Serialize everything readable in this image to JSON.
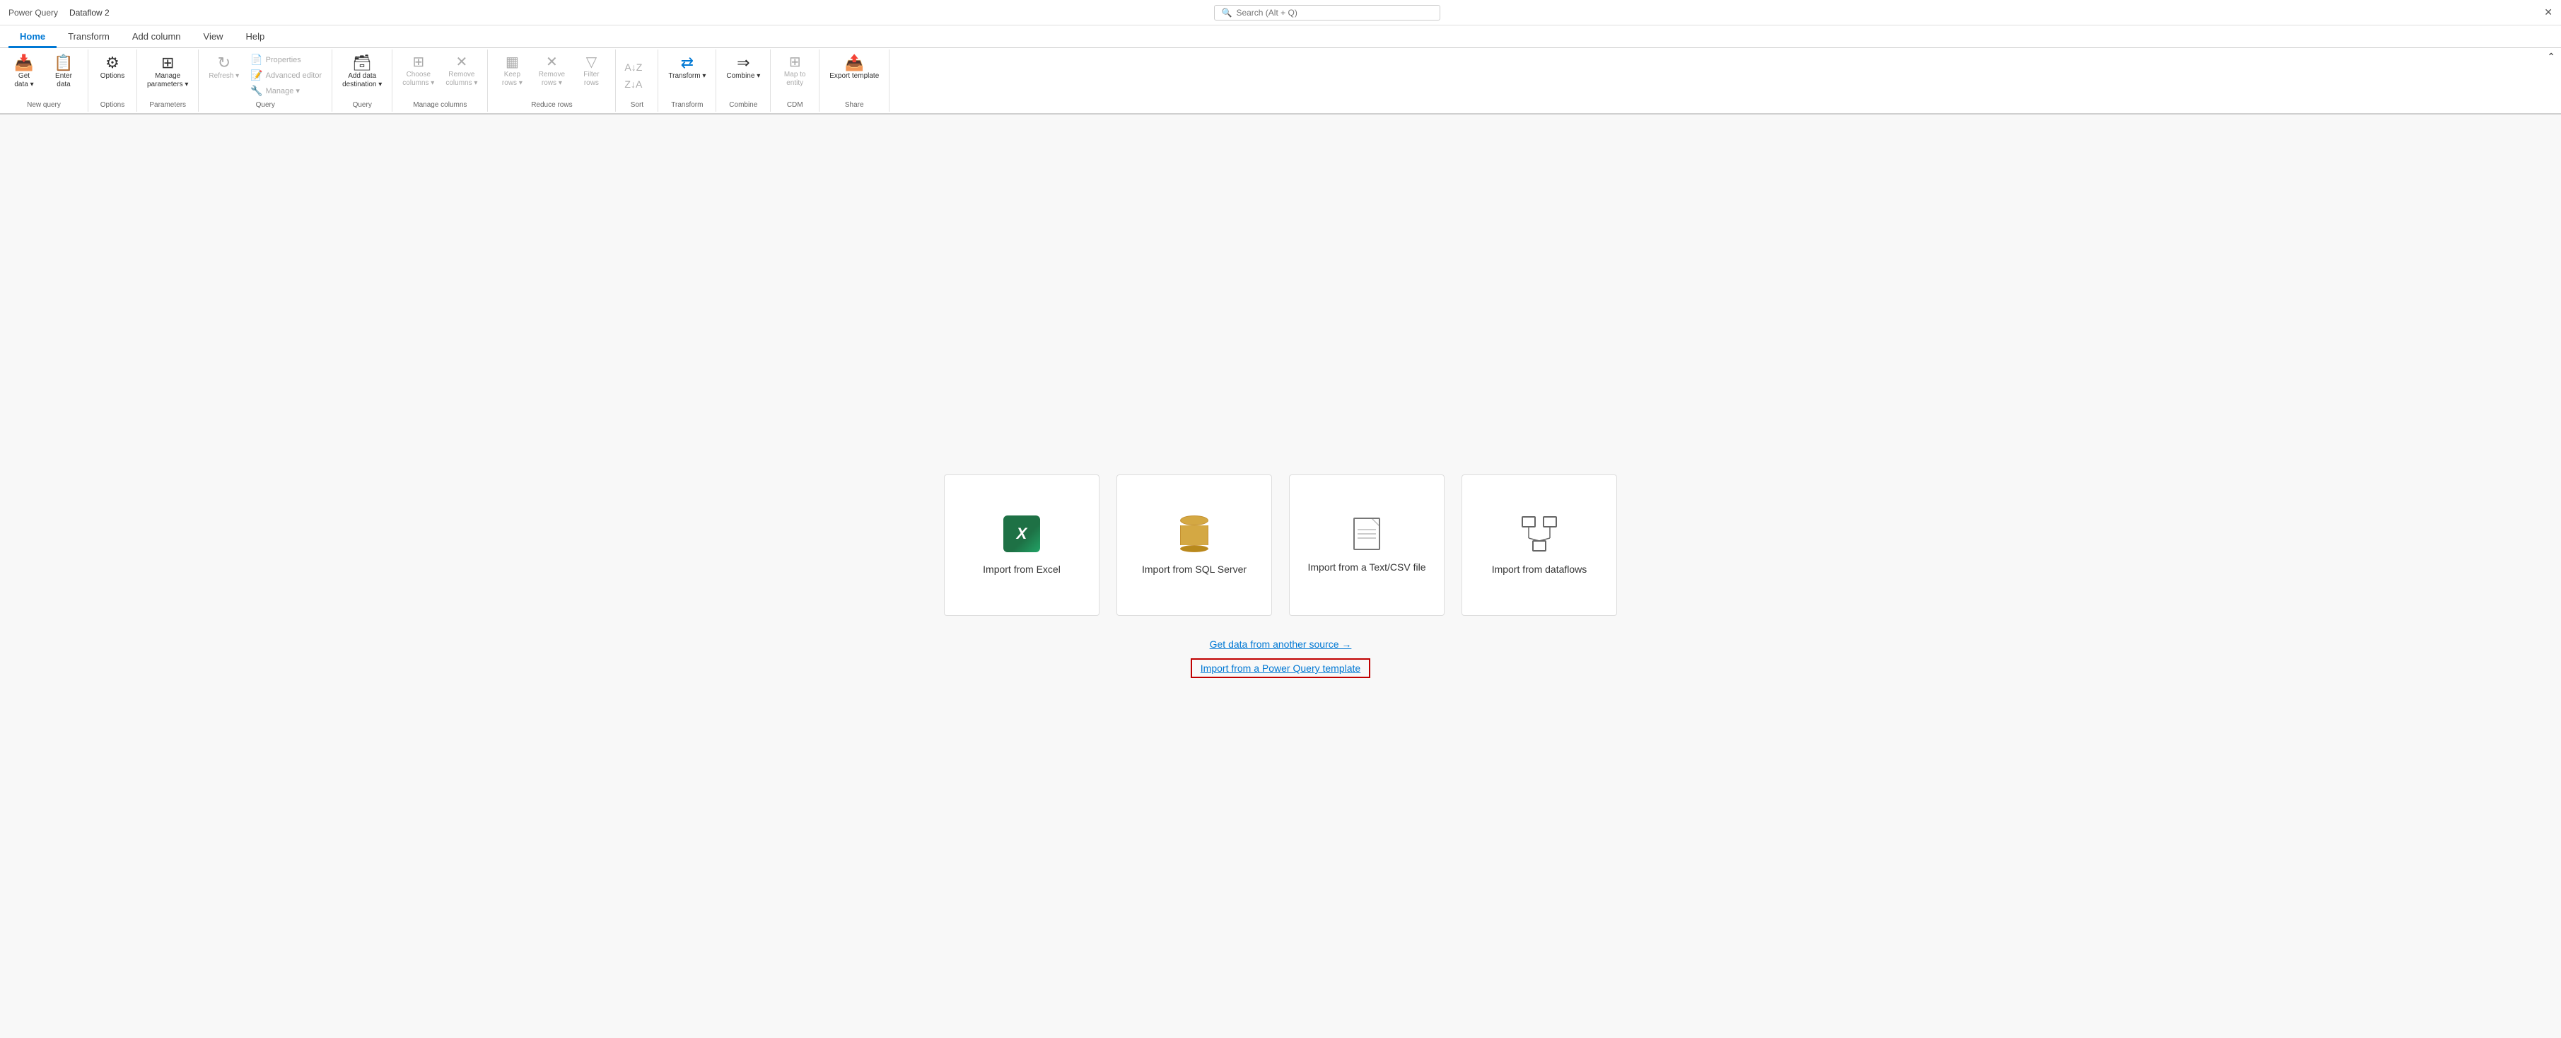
{
  "titleBar": {
    "appName": "Power Query",
    "docName": "Dataflow 2",
    "searchPlaceholder": "Search (Alt + Q)",
    "closeLabel": "✕"
  },
  "ribbonTabs": [
    {
      "id": "home",
      "label": "Home",
      "active": true
    },
    {
      "id": "transform",
      "label": "Transform",
      "active": false
    },
    {
      "id": "addColumn",
      "label": "Add column",
      "active": false
    },
    {
      "id": "view",
      "label": "View",
      "active": false
    },
    {
      "id": "help",
      "label": "Help",
      "active": false
    }
  ],
  "ribbon": {
    "groups": [
      {
        "id": "new-query",
        "label": "New query",
        "items": [
          {
            "id": "get-data",
            "label": "Get\ndata",
            "type": "large",
            "icon": "📥"
          },
          {
            "id": "enter-data",
            "label": "Enter\ndata",
            "type": "large",
            "icon": "📋"
          }
        ]
      },
      {
        "id": "options",
        "label": "Options",
        "items": [
          {
            "id": "options-btn",
            "label": "Options",
            "type": "large",
            "icon": "⚙"
          }
        ]
      },
      {
        "id": "parameters",
        "label": "Parameters",
        "items": [
          {
            "id": "manage-parameters",
            "label": "Manage\nparameters",
            "type": "large",
            "icon": "⊞"
          }
        ]
      },
      {
        "id": "query",
        "label": "Query",
        "items": [
          {
            "id": "refresh",
            "label": "Refresh",
            "type": "large",
            "icon": "↻",
            "disabled": true
          },
          {
            "id": "advanced-editor",
            "label": "Advanced editor",
            "type": "small",
            "disabled": true
          },
          {
            "id": "properties",
            "label": "Properties",
            "type": "small",
            "disabled": true
          },
          {
            "id": "manage",
            "label": "Manage",
            "type": "small",
            "disabled": true
          }
        ]
      },
      {
        "id": "add-data-destination",
        "label": "Query",
        "items": [
          {
            "id": "add-data-dest",
            "label": "Add data\ndestination",
            "type": "large",
            "icon": "🗃"
          }
        ]
      },
      {
        "id": "manage-columns",
        "label": "Manage columns",
        "items": [
          {
            "id": "choose-columns",
            "label": "Choose\ncolumns",
            "type": "large",
            "icon": "⊞",
            "disabled": true
          },
          {
            "id": "remove-columns",
            "label": "Remove\ncolumns",
            "type": "large",
            "icon": "✕",
            "disabled": true
          }
        ]
      },
      {
        "id": "reduce-rows",
        "label": "Reduce rows",
        "items": [
          {
            "id": "keep-rows",
            "label": "Keep\nrows",
            "type": "large",
            "icon": "▦",
            "disabled": true
          },
          {
            "id": "remove-rows",
            "label": "Remove\nrows",
            "type": "large",
            "icon": "✕",
            "disabled": true
          },
          {
            "id": "filter-rows",
            "label": "Filter\nrows",
            "type": "large",
            "icon": "▽",
            "disabled": true
          }
        ]
      },
      {
        "id": "sort",
        "label": "Sort",
        "items": [
          {
            "id": "sort-az",
            "label": "A→Z",
            "type": "sort"
          },
          {
            "id": "sort-za",
            "label": "Z→A",
            "type": "sort"
          }
        ]
      },
      {
        "id": "transform-group",
        "label": "Transform",
        "items": [
          {
            "id": "transform-btn",
            "label": "Transform",
            "type": "large",
            "icon": "⇄",
            "disabled": false
          }
        ]
      },
      {
        "id": "combine-group",
        "label": "Combine",
        "items": [
          {
            "id": "combine-btn",
            "label": "Combine",
            "type": "large",
            "icon": "⇒",
            "disabled": false
          }
        ]
      },
      {
        "id": "cdm",
        "label": "CDM",
        "items": [
          {
            "id": "map-to-entity",
            "label": "Map to\nentity",
            "type": "large",
            "icon": "⊞",
            "disabled": true
          }
        ]
      },
      {
        "id": "share",
        "label": "Share",
        "items": [
          {
            "id": "export-template",
            "label": "Export template",
            "type": "large",
            "icon": "📤"
          }
        ]
      }
    ]
  },
  "mainContent": {
    "cards": [
      {
        "id": "import-excel",
        "label": "Import from Excel",
        "iconType": "excel"
      },
      {
        "id": "import-sql",
        "label": "Import from SQL Server",
        "iconType": "sql"
      },
      {
        "id": "import-csv",
        "label": "Import from a Text/CSV file",
        "iconType": "doc"
      },
      {
        "id": "import-dataflows",
        "label": "Import from dataflows",
        "iconType": "dataflow"
      }
    ],
    "links": [
      {
        "id": "get-another-source",
        "label": "Get data from another source →",
        "type": "blue"
      },
      {
        "id": "import-template",
        "label": "Import from a Power Query template",
        "type": "red-box"
      }
    ]
  }
}
